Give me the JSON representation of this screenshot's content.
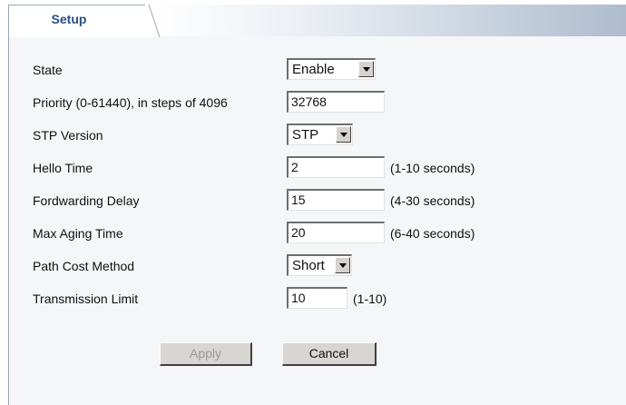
{
  "tabs": [
    {
      "label": "Setup",
      "active": true
    }
  ],
  "form": {
    "rows": [
      {
        "label": "State",
        "type": "select",
        "value": "Enable"
      },
      {
        "label": "Priority (0-61440), in steps of 4096",
        "type": "input",
        "value": "32768"
      },
      {
        "label": "STP Version",
        "type": "select",
        "value": "STP"
      },
      {
        "label": "Hello Time",
        "type": "input",
        "value": "2",
        "hint": "(1-10 seconds)"
      },
      {
        "label": "Fordwarding Delay",
        "type": "input",
        "value": "15",
        "hint": "(4-30 seconds)"
      },
      {
        "label": "Max Aging Time",
        "type": "input",
        "value": "20",
        "hint": "(6-40 seconds)"
      },
      {
        "label": "Path Cost Method",
        "type": "select",
        "value": "Short"
      },
      {
        "label": "Transmission Limit",
        "type": "input",
        "value": "10",
        "hint": "(1-10)"
      }
    ]
  },
  "buttons": {
    "apply": {
      "label": "Apply",
      "enabled": false
    },
    "cancel": {
      "label": "Cancel",
      "enabled": true
    }
  },
  "colors": {
    "tab_text": "#2a4c86",
    "panel_bg": "#f5f6f8",
    "button_face": "#d8d6d2"
  }
}
